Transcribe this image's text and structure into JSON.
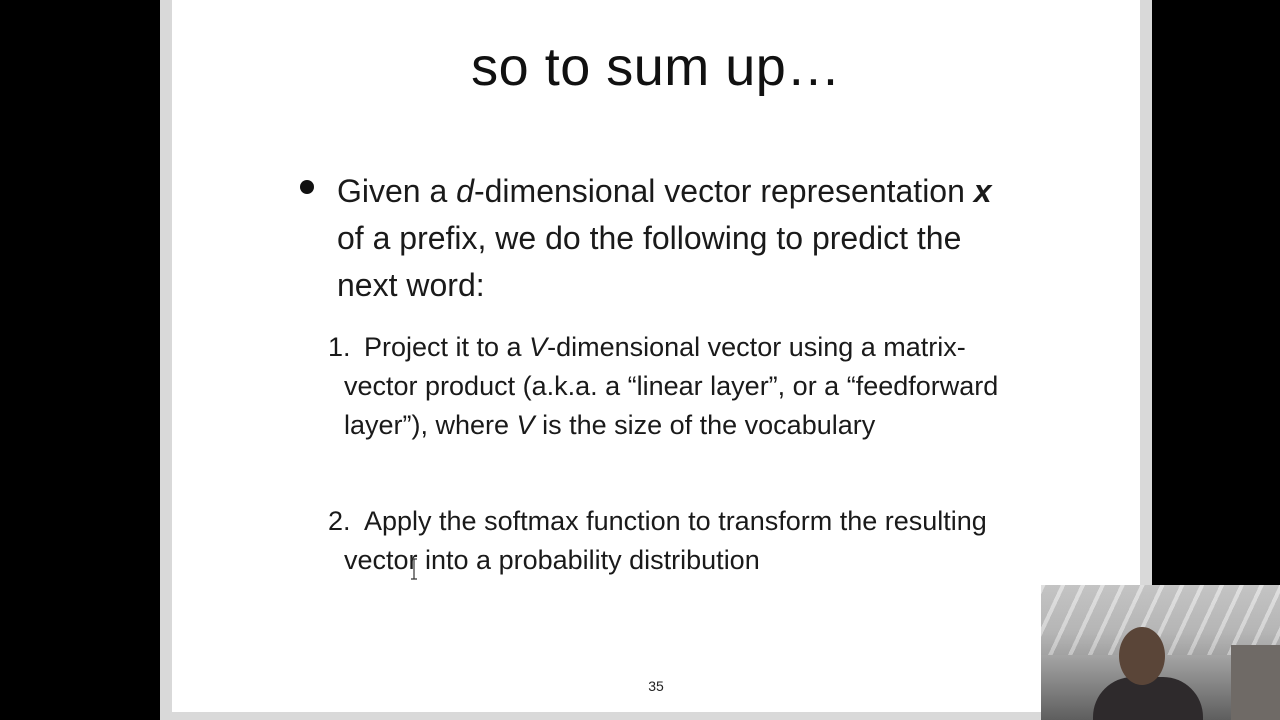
{
  "slide": {
    "title": "so to sum up…",
    "bullet": {
      "prefix": "Given a ",
      "d": "d",
      "mid1": "-dimensional vector representation ",
      "x": "x",
      "mid2": " of a prefix, we do the following to predict the next word:"
    },
    "items": [
      {
        "number": "1.",
        "text_a": "Project it to a ",
        "v1": "V",
        "text_b": "-dimensional vector using a matrix-vector product (a.k.a. a “linear layer”, or a “feedforward layer”), where ",
        "v2": "V",
        "text_c": " is the size of the vocabulary"
      },
      {
        "number": "2.",
        "text": "Apply the softmax function to transform the resulting vector into a probability distribution"
      }
    ],
    "page_number": "35"
  },
  "icons": {
    "cursor": "text-cursor-icon"
  },
  "colors": {
    "background": "#000000",
    "slide": "#ffffff",
    "text": "#1a1a1a"
  }
}
